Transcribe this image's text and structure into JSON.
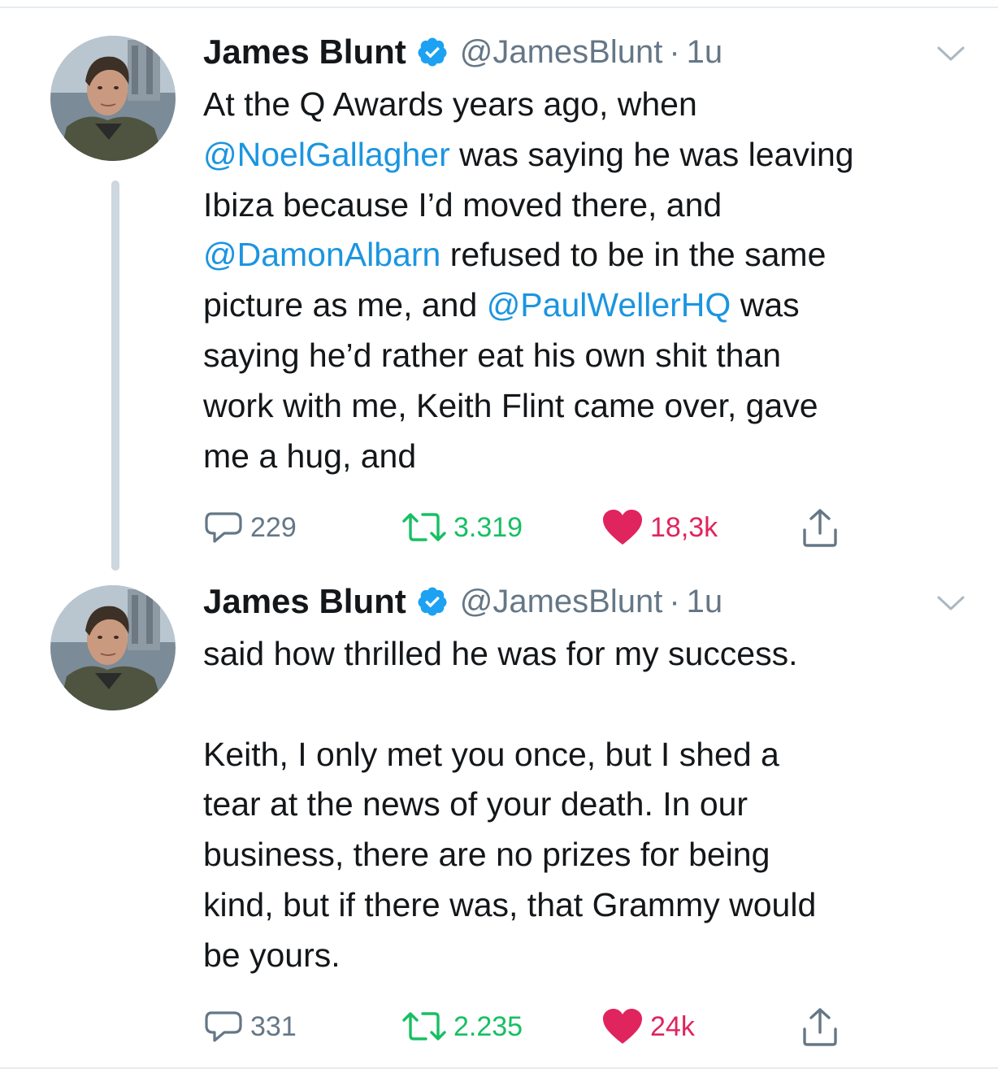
{
  "colors": {
    "link": "#1b95e0",
    "secondary": "#657786",
    "retweet": "#17bf63",
    "like": "#e0245e",
    "verified": "#1da1f2",
    "thread_line": "#cdd7df"
  },
  "tweets": [
    {
      "author": {
        "name": "James Blunt",
        "handle": "@JamesBlunt",
        "verified": true
      },
      "dot": "·",
      "time": "1u",
      "lines": [
        [
          {
            "t": "At the Q Awards years ago, when"
          }
        ],
        [
          {
            "t": "@NoelGallagher",
            "m": true
          },
          {
            "t": " was saying he was leaving"
          }
        ],
        [
          {
            "t": "Ibiza because I’d moved there, and"
          }
        ],
        [
          {
            "t": "@DamonAlbarn",
            "m": true
          },
          {
            "t": " refused to be in the same"
          }
        ],
        [
          {
            "t": "picture as me, and "
          },
          {
            "t": "@PaulWellerHQ",
            "m": true
          },
          {
            "t": " was"
          }
        ],
        [
          {
            "t": "saying he’d rather eat his own shit than"
          }
        ],
        [
          {
            "t": "work with me, Keith Flint came over, gave"
          }
        ],
        [
          {
            "t": "me a hug, and"
          }
        ]
      ],
      "stats": {
        "replies": "229",
        "retweets": "3.319",
        "likes": "18,3k"
      }
    },
    {
      "author": {
        "name": "James Blunt",
        "handle": "@JamesBlunt",
        "verified": true
      },
      "dot": "·",
      "time": "1u",
      "lines": [
        [
          {
            "t": "said how thrilled he was for my success."
          }
        ],
        [
          {
            "t": ""
          }
        ],
        [
          {
            "t": "Keith, I only met you once, but I shed a"
          }
        ],
        [
          {
            "t": "tear at the news of your death. In our"
          }
        ],
        [
          {
            "t": "business, there are no prizes for being"
          }
        ],
        [
          {
            "t": "kind, but if there was, that Grammy would"
          }
        ],
        [
          {
            "t": "be yours."
          }
        ]
      ],
      "stats": {
        "replies": "331",
        "retweets": "2.235",
        "likes": "24k"
      }
    }
  ]
}
